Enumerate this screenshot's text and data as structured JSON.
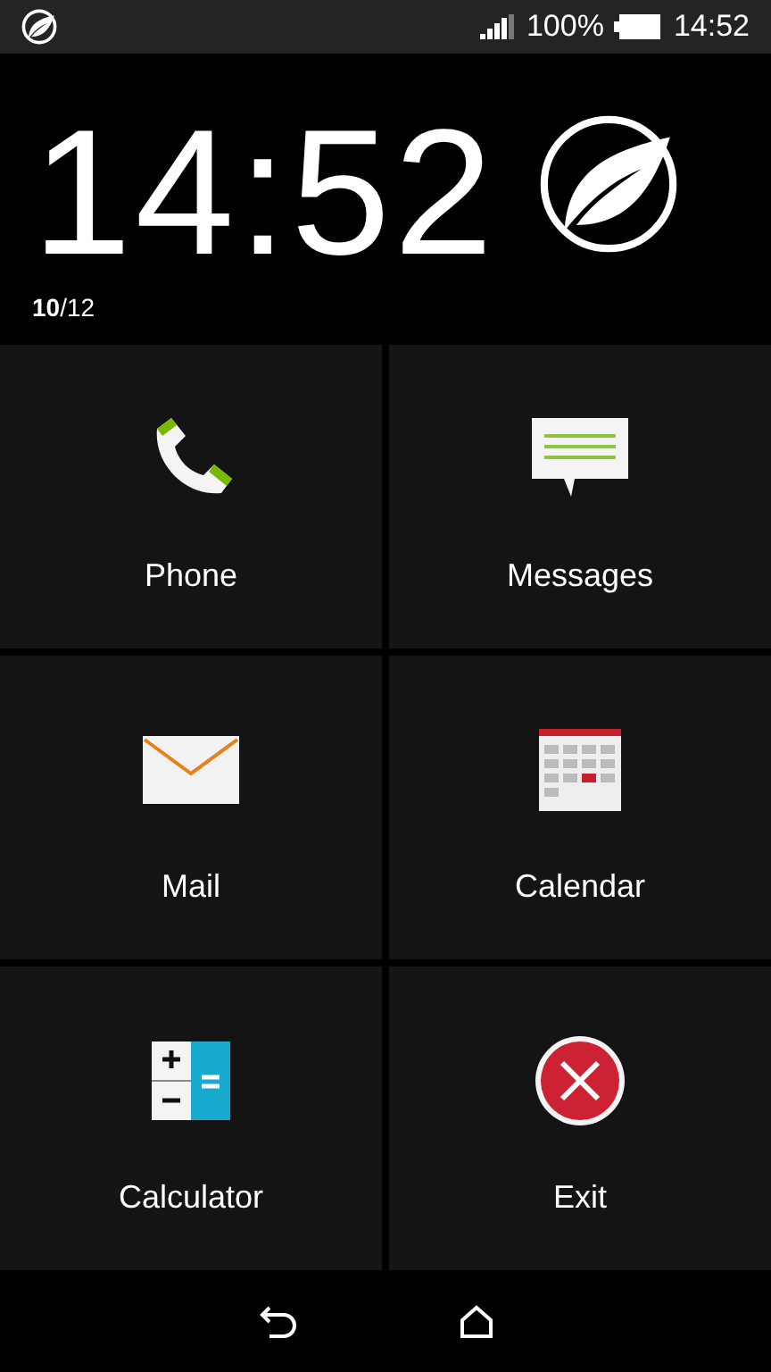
{
  "status_bar": {
    "battery_text": "100%",
    "time": "14:52"
  },
  "clock": {
    "time": "14:52",
    "date": "**10**/12"
  },
  "tiles": [
    {
      "kind": "phone",
      "label": "Phone"
    },
    {
      "kind": "messages",
      "label": "Messages"
    },
    {
      "kind": "mail",
      "label": "Mail"
    },
    {
      "kind": "calendar",
      "label": "Calendar"
    },
    {
      "kind": "calculator",
      "label": "Calculator"
    },
    {
      "kind": "exit",
      "label": "Exit"
    }
  ]
}
